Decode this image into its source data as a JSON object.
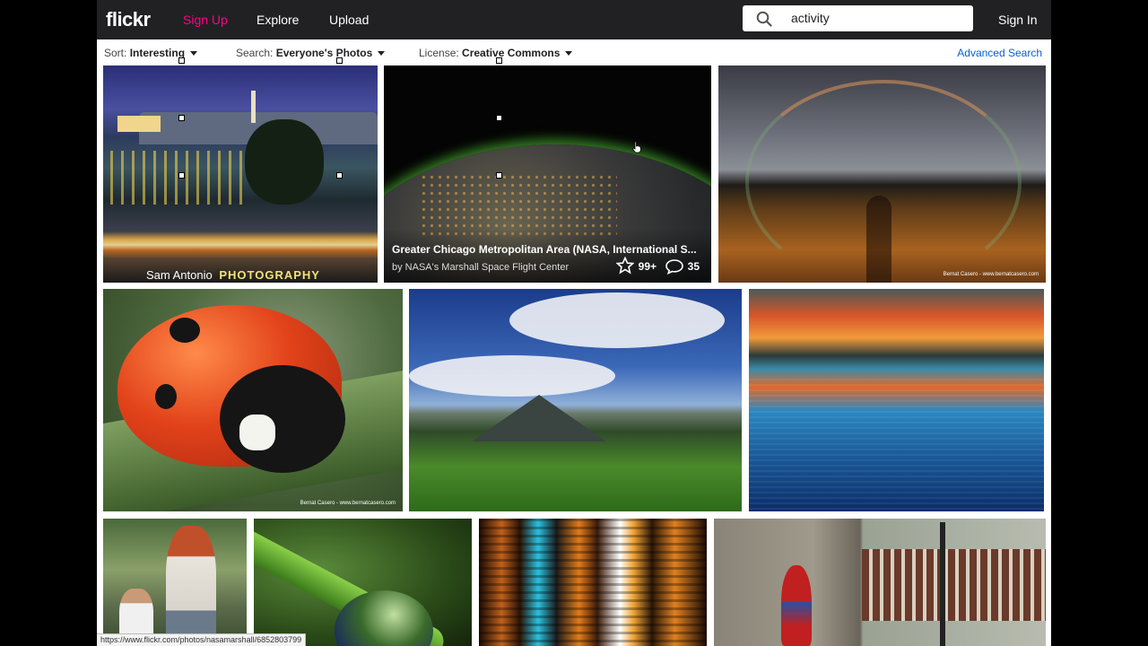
{
  "nav": {
    "logo": "flickr",
    "signup": "Sign Up",
    "explore": "Explore",
    "upload": "Upload",
    "search_value": "activity",
    "signin": "Sign In"
  },
  "filters": {
    "sort_label": "Sort:",
    "sort_value": "Interesting",
    "search_label": "Search:",
    "search_value": "Everyone's Photos",
    "license_label": "License:",
    "license_value": "Creative Commons",
    "advanced": "Advanced Search"
  },
  "photos": [
    {
      "watermark_a": "Sam Antonio",
      "watermark_b": "PHOTOGRAPHY"
    },
    {
      "title": "Greater Chicago Metropolitan Area (NASA, International S...",
      "by": "by NASA's Marshall Space Flight Center",
      "faves": "99+",
      "comments": "35"
    },
    {
      "watermark": "Bernat Casero - www.bernatcasero.com"
    },
    {
      "watermark": "Bernat Casero - www.bernatcasero.com"
    }
  ],
  "status_url": "https://www.flickr.com/photos/nasamarshall/6852803799",
  "colors": {
    "topbar": "#212124",
    "signup": "#ff0084",
    "link": "#0063dc"
  }
}
